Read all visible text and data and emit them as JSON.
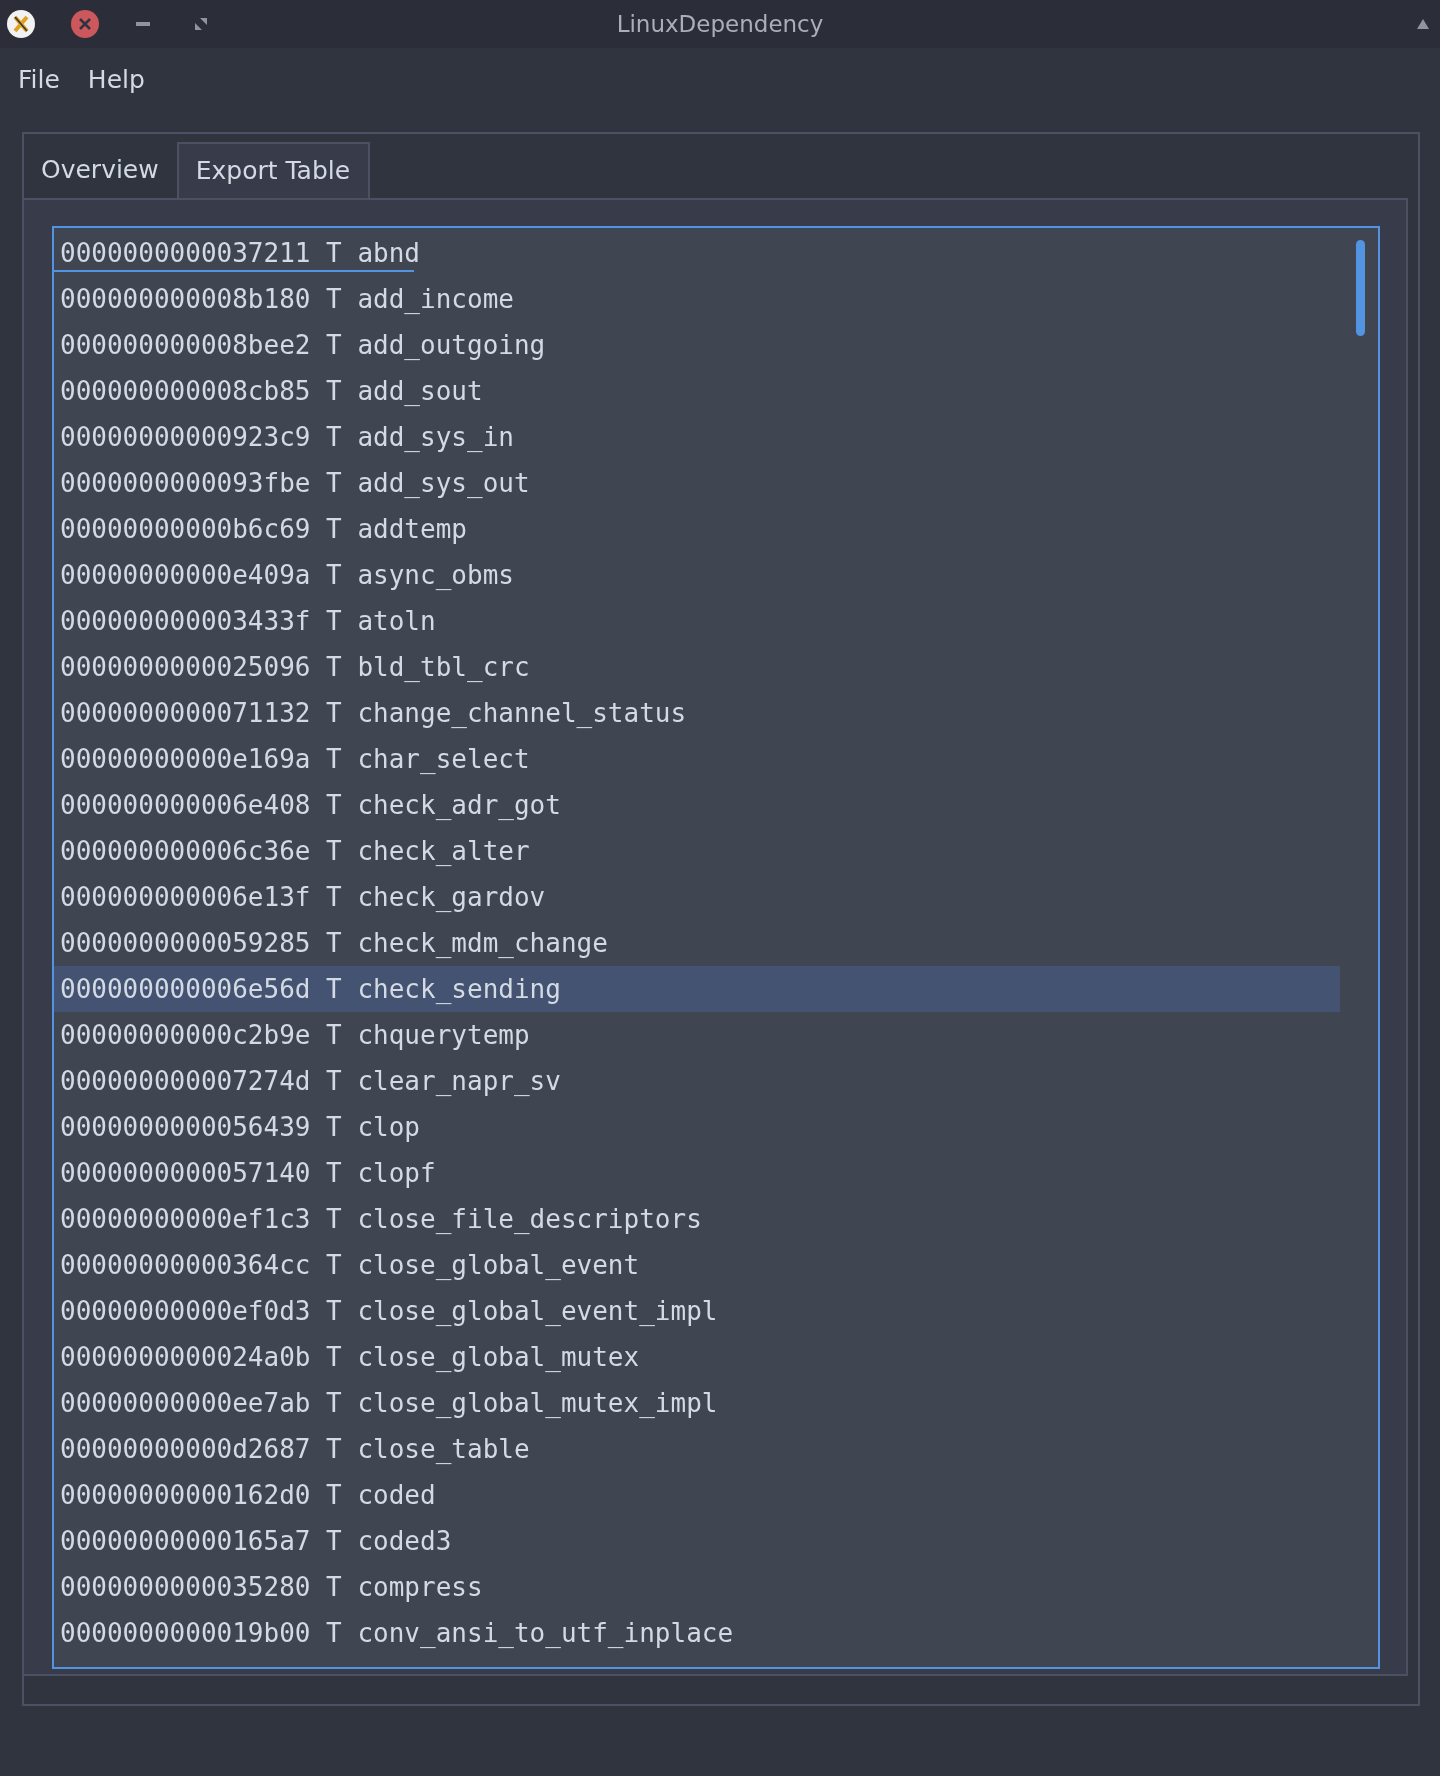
{
  "window": {
    "title": "LinuxDependency"
  },
  "menu": [
    "File",
    "Help"
  ],
  "tabs": [
    {
      "label": "Overview",
      "selected": false
    },
    {
      "label": "Export Table",
      "selected": true
    }
  ],
  "rows": [
    {
      "text": "0000000000037211 T abnd",
      "selected": false,
      "current": true
    },
    {
      "text": "000000000008b180 T add_income",
      "selected": false,
      "current": false
    },
    {
      "text": "000000000008bee2 T add_outgoing",
      "selected": false,
      "current": false
    },
    {
      "text": "000000000008cb85 T add_sout",
      "selected": false,
      "current": false
    },
    {
      "text": "00000000000923c9 T add_sys_in",
      "selected": false,
      "current": false
    },
    {
      "text": "0000000000093fbe T add_sys_out",
      "selected": false,
      "current": false
    },
    {
      "text": "00000000000b6c69 T addtemp",
      "selected": false,
      "current": false
    },
    {
      "text": "00000000000e409a T async_obms",
      "selected": false,
      "current": false
    },
    {
      "text": "000000000003433f T atoln",
      "selected": false,
      "current": false
    },
    {
      "text": "0000000000025096 T bld_tbl_crc",
      "selected": false,
      "current": false
    },
    {
      "text": "0000000000071132 T change_channel_status",
      "selected": false,
      "current": false
    },
    {
      "text": "00000000000e169a T char_select",
      "selected": false,
      "current": false
    },
    {
      "text": "000000000006e408 T check_adr_got",
      "selected": false,
      "current": false
    },
    {
      "text": "000000000006c36e T check_alter",
      "selected": false,
      "current": false
    },
    {
      "text": "000000000006e13f T check_gardov",
      "selected": false,
      "current": false
    },
    {
      "text": "0000000000059285 T check_mdm_change",
      "selected": false,
      "current": false
    },
    {
      "text": "000000000006e56d T check_sending",
      "selected": true,
      "current": false
    },
    {
      "text": "00000000000c2b9e T chquerytemp",
      "selected": false,
      "current": false
    },
    {
      "text": "000000000007274d T clear_napr_sv",
      "selected": false,
      "current": false
    },
    {
      "text": "0000000000056439 T clop",
      "selected": false,
      "current": false
    },
    {
      "text": "0000000000057140 T clopf",
      "selected": false,
      "current": false
    },
    {
      "text": "00000000000ef1c3 T close_file_descriptors",
      "selected": false,
      "current": false
    },
    {
      "text": "00000000000364cc T close_global_event",
      "selected": false,
      "current": false
    },
    {
      "text": "00000000000ef0d3 T close_global_event_impl",
      "selected": false,
      "current": false
    },
    {
      "text": "0000000000024a0b T close_global_mutex",
      "selected": false,
      "current": false
    },
    {
      "text": "00000000000ee7ab T close_global_mutex_impl",
      "selected": false,
      "current": false
    },
    {
      "text": "00000000000d2687 T close_table",
      "selected": false,
      "current": false
    },
    {
      "text": "00000000000162d0 T coded",
      "selected": false,
      "current": false
    },
    {
      "text": "00000000000165a7 T coded3",
      "selected": false,
      "current": false
    },
    {
      "text": "0000000000035280 T compress",
      "selected": false,
      "current": false
    },
    {
      "text": "0000000000019b00 T conv_ansi_to_utf_inplace",
      "selected": false,
      "current": false
    }
  ]
}
